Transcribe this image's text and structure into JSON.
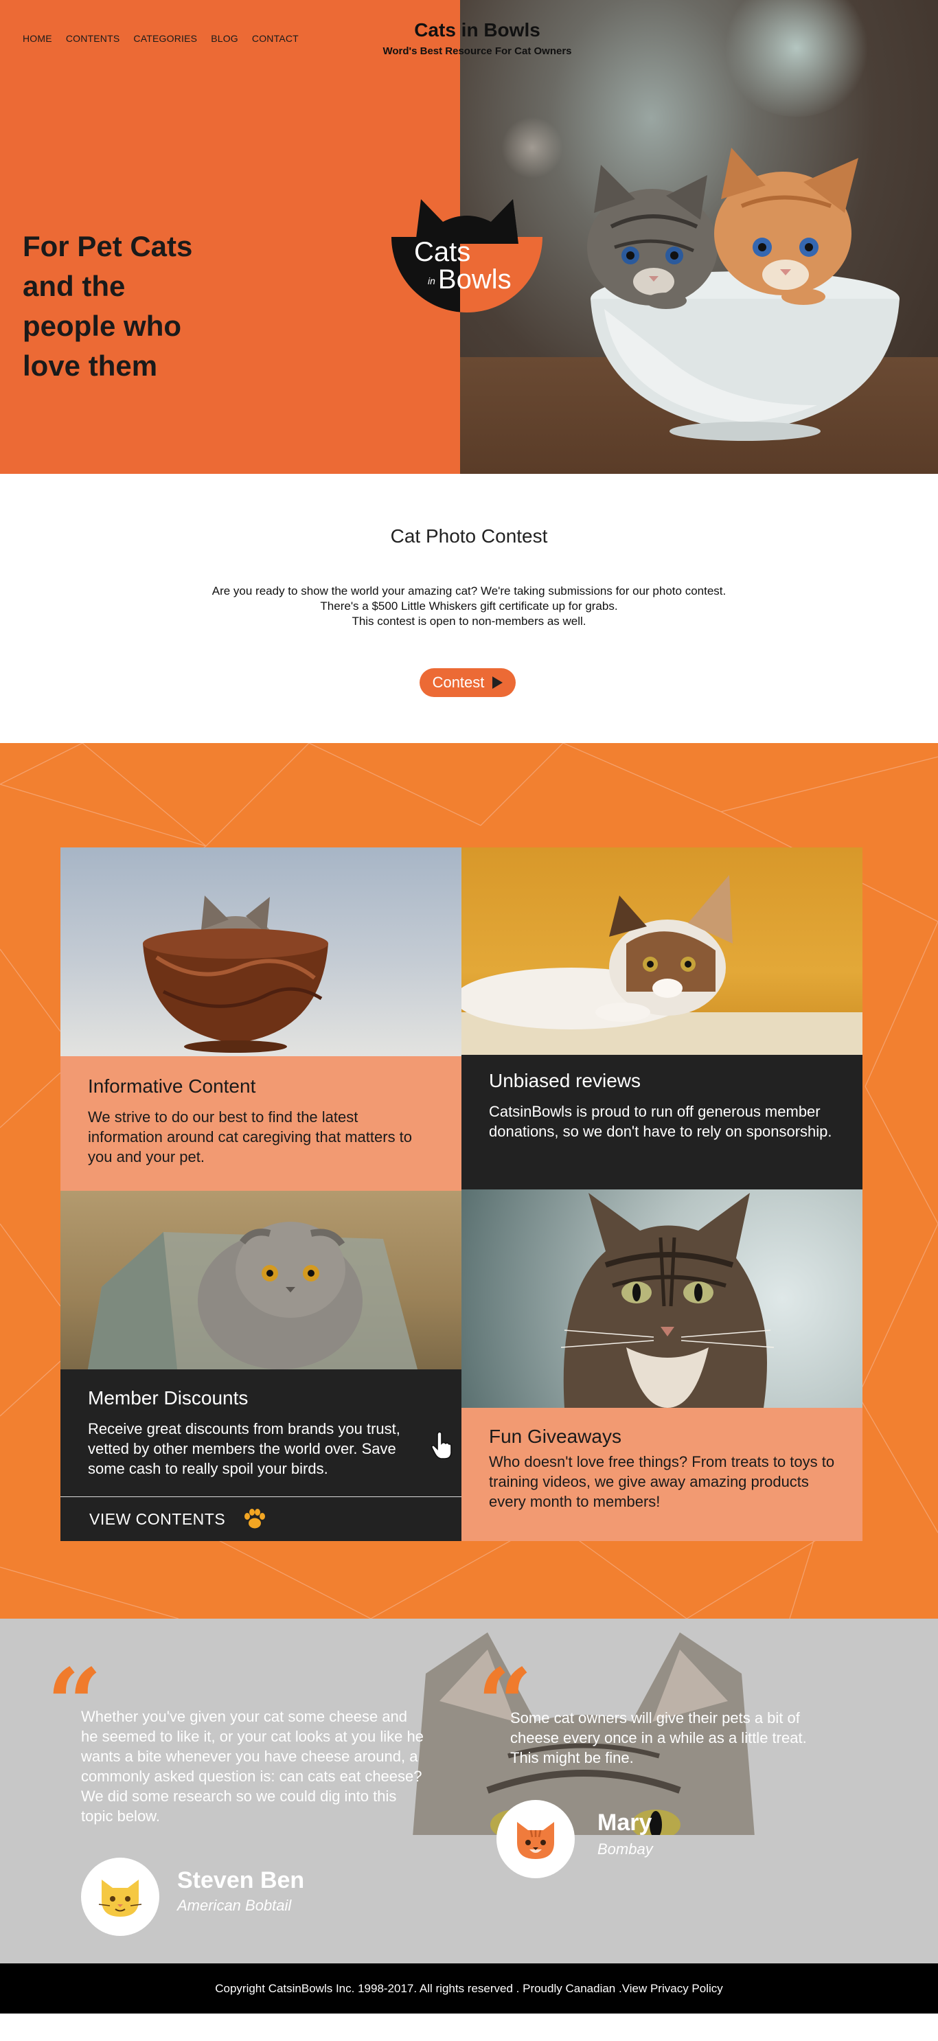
{
  "nav": {
    "items": [
      "HOME",
      "CONTENTS",
      "CATEGORIES",
      "BLOG",
      "CONTACT"
    ]
  },
  "brand": {
    "title": "Cats in Bowls",
    "subtitle": "Word's Best Resource For Cat Owners"
  },
  "hero": {
    "tagline_lines": [
      "For Pet Cats",
      "and the",
      "people who",
      "love them"
    ],
    "logo": {
      "cats": "Cats",
      "in": "in",
      "bowls": "Bowls"
    }
  },
  "contest": {
    "title": "Cat Photo Contest",
    "lines": [
      "Are you ready to show the world your amazing cat? We're taking submissions for our photo contest.",
      "There's a $500 Little Whiskers gift certificate up for grabs.",
      "This contest is open to non-members as well."
    ],
    "button_label": "Contest"
  },
  "features": {
    "cards": [
      {
        "title": "Informative Content",
        "text": "We strive to do our best to find the latest information around cat caregiving that matters to you and your pet."
      },
      {
        "title": "Unbiased reviews",
        "text": "CatsinBowls is proud to run off generous member donations, so we don't have to rely on sponsorship."
      },
      {
        "title": "Member Discounts",
        "text": "Receive great discounts from brands you trust, vetted by other members the world over. Save some cash to really spoil your birds."
      },
      {
        "title": "Fun Giveaways",
        "text": "Who doesn't love free things? From treats to toys to training videos, we give away amazing products every month to members!"
      }
    ],
    "view_label": "VIEW CONTENTS"
  },
  "testimonials": [
    {
      "quote": "Whether you've given your cat some cheese and he seemed to like it, or your cat looks at you like he wants a bite whenever you have cheese around, a commonly asked question is: can cats eat cheese? We did some research so we could dig into this topic below.",
      "name": "Steven Ben",
      "breed": "American Bobtail"
    },
    {
      "quote": "Some cat owners will give their pets a bit of cheese every once in a while as a little treat. This might be fine.",
      "name": "Mary",
      "breed": "Bombay"
    }
  ],
  "footer": {
    "copyright": "Copyright CatsinBowls Inc. 1998-2017. All rights reserved . Proudly Canadian . ",
    "privacy": "View Privacy Policy"
  },
  "colors": {
    "accent": "#ec6a35",
    "features_bg": "#f28030",
    "panel_light": "#f29a72",
    "panel_dark": "#222222",
    "quote_mark": "#f07b2c"
  }
}
